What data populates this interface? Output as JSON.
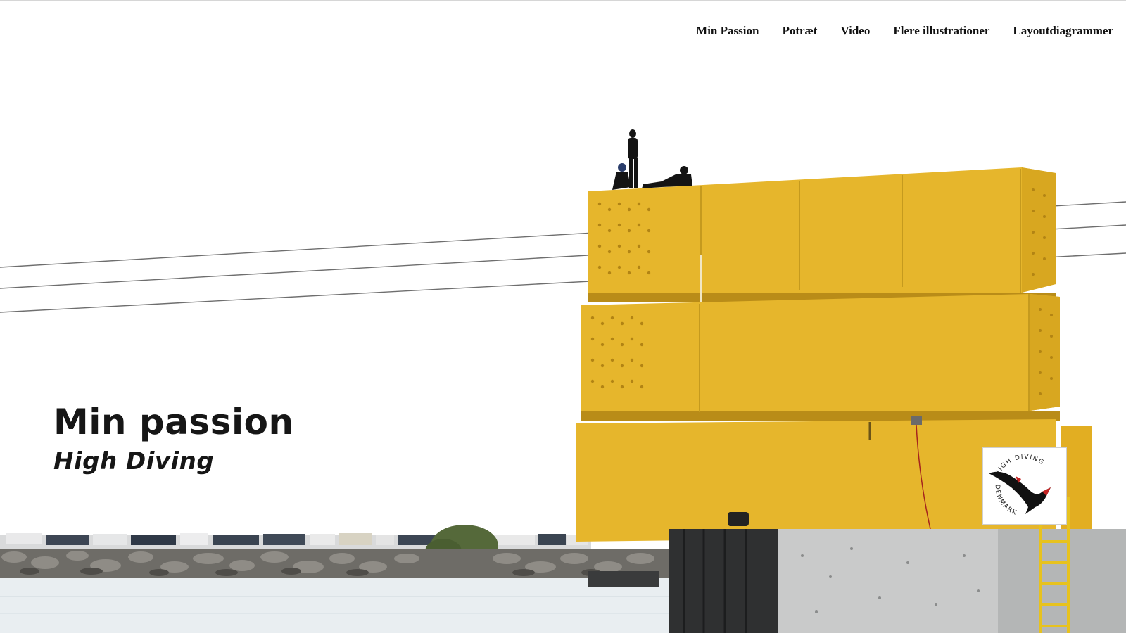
{
  "nav": {
    "items": [
      {
        "label": "Min Passion"
      },
      {
        "label": "Potræt"
      },
      {
        "label": "Video"
      },
      {
        "label": "Flere illustrationer"
      },
      {
        "label": "Layoutdiagrammer"
      }
    ]
  },
  "hero": {
    "title": "Min passion",
    "subtitle": "High Diving",
    "image": "high-diving-container-tower",
    "logo": {
      "line1": "HIGH DIVING",
      "line2": "DENMARK"
    }
  },
  "colors": {
    "container_yellow": "#E6B62C",
    "container_shadow": "#B98C18",
    "water": "#E9EEF1",
    "concrete": "#C9CACA",
    "text": "#161616"
  }
}
